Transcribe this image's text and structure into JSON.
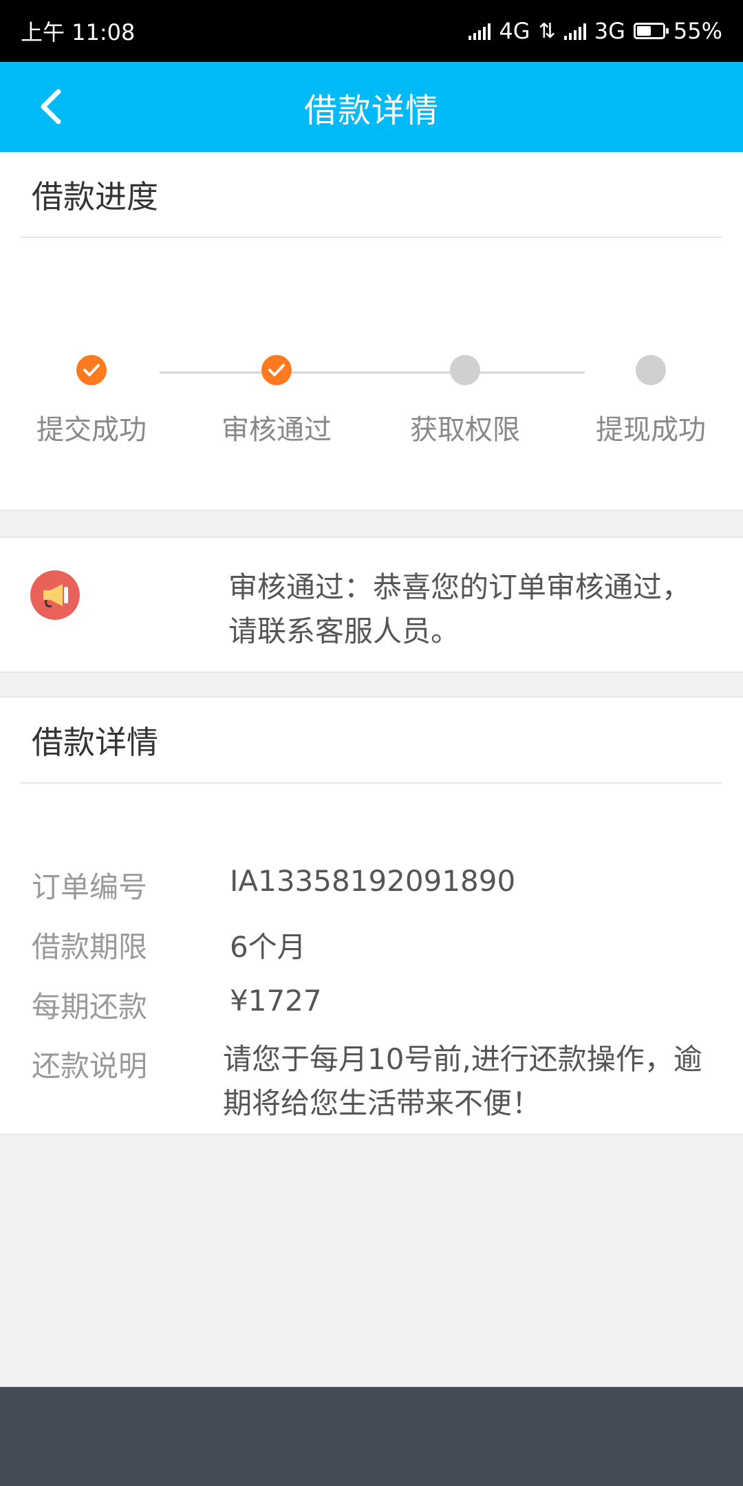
{
  "status_bar": {
    "time": "上午 11:08",
    "net1": "4G",
    "net2": "3G",
    "battery": "55%",
    "battery_level": 0.55
  },
  "nav": {
    "title": "借款详情",
    "back_icon": "chevron-left-icon"
  },
  "progress_section": {
    "title": "借款进度",
    "steps": [
      {
        "label": "提交成功",
        "done": true
      },
      {
        "label": "审核通过",
        "done": true
      },
      {
        "label": "获取权限",
        "done": false
      },
      {
        "label": "提现成功",
        "done": false
      }
    ],
    "done_color": "#ff7a1e",
    "todo_color": "#d0d0d0"
  },
  "notice": {
    "icon": "megaphone-icon",
    "text": "审核通过：恭喜您的订单审核通过，请联系客服人员。"
  },
  "details": {
    "title": "借款详情",
    "rows": [
      {
        "key": "订单编号",
        "value": "IA13358192091890"
      },
      {
        "key": "借款期限",
        "value": "6个月"
      },
      {
        "key": "每期还款",
        "value": "¥1727"
      },
      {
        "key": "还款说明",
        "value": "请您于每月10号前,进行还款操作，逾期将给您生活带来不便！"
      }
    ]
  },
  "colors": {
    "header": "#00baf8",
    "bottom_bar": "#464c55"
  }
}
